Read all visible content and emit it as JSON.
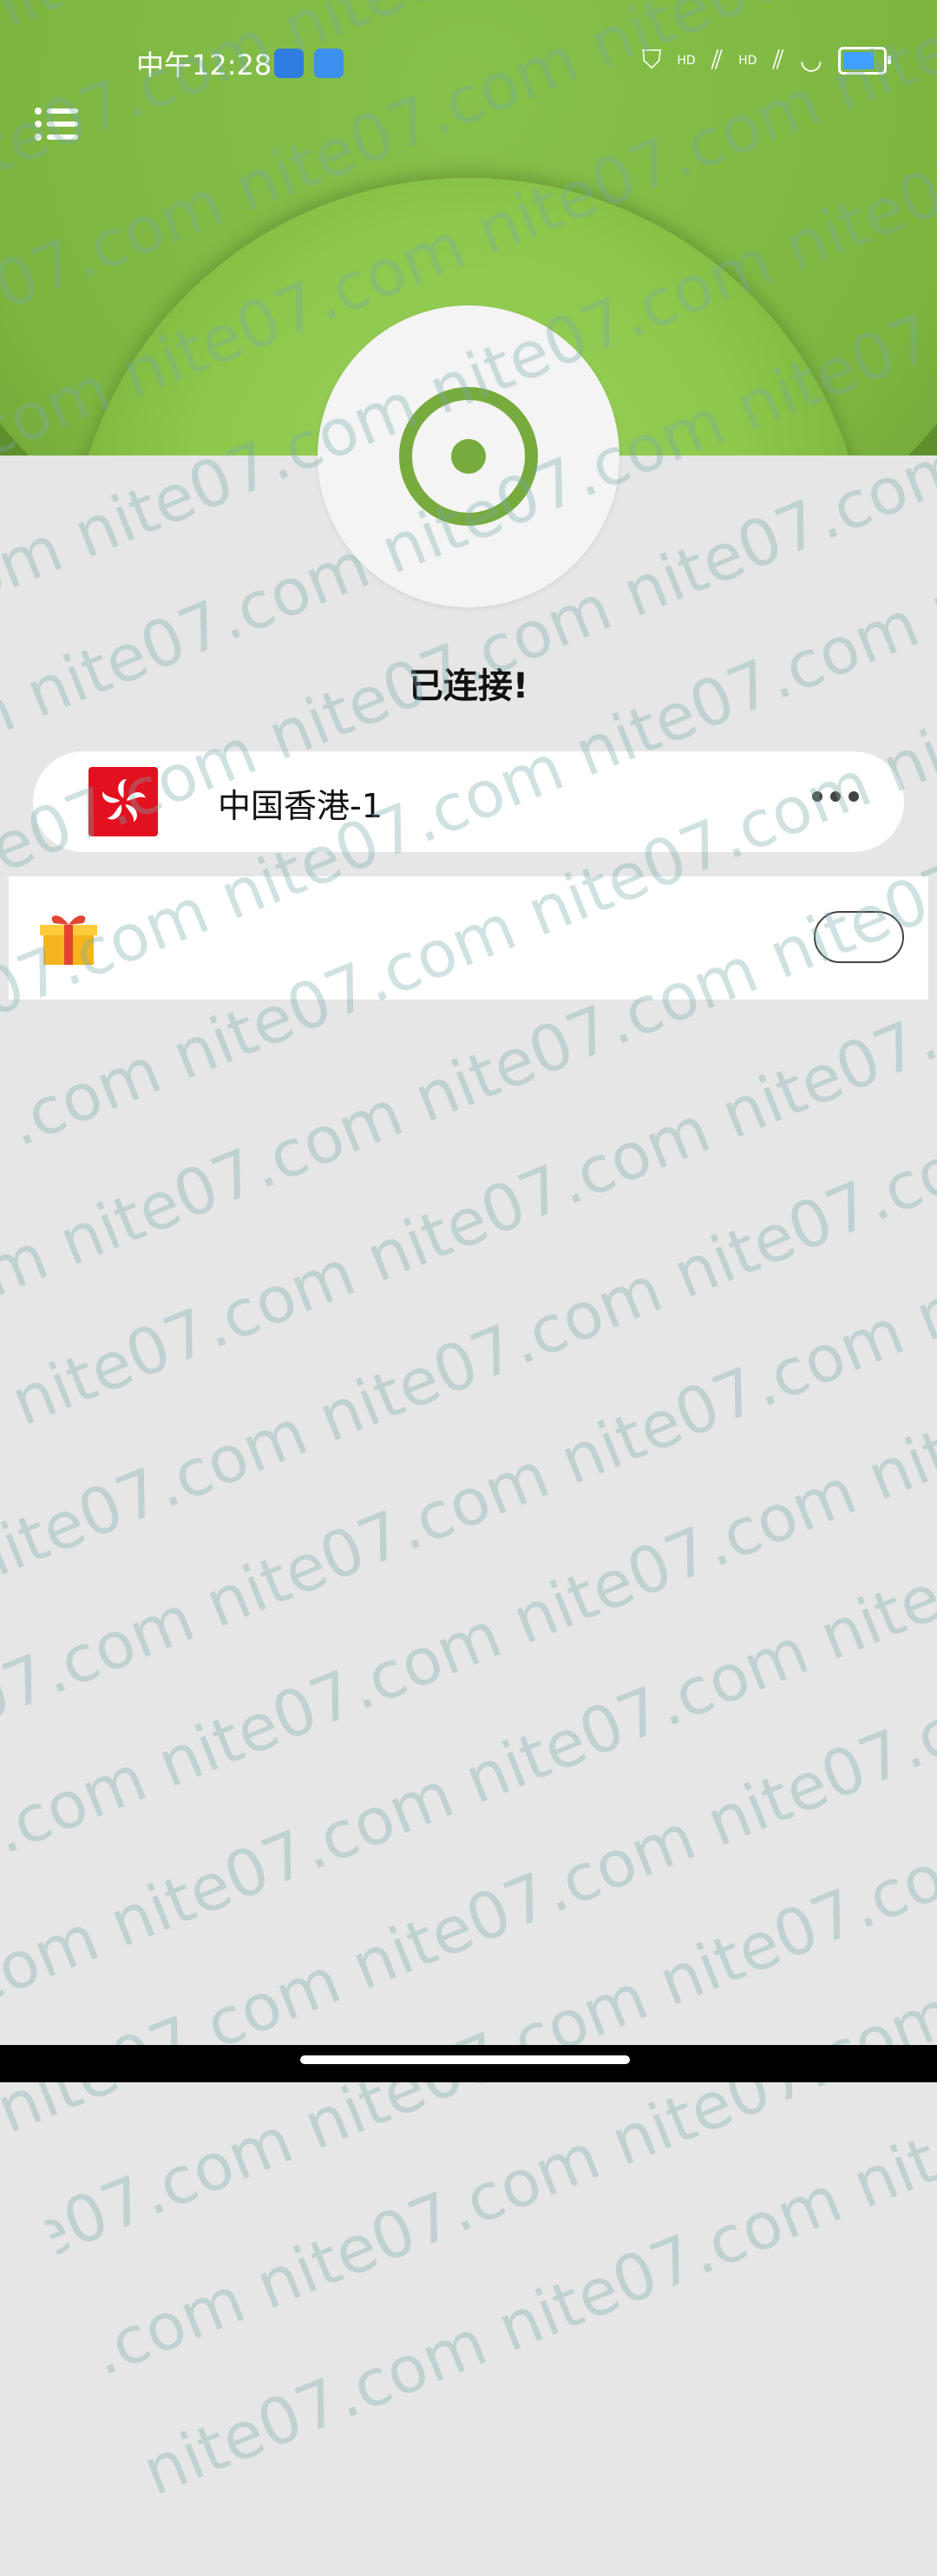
{
  "status_bar": {
    "time": "中午12:28",
    "hd_label_1": "HD",
    "hd_label_2": "HD"
  },
  "colors": {
    "accent_green": "#78ab3e",
    "flag_red": "#e3101f",
    "battery_blue": "#3fa0ff"
  },
  "main": {
    "connection_status": "已连接!",
    "server": {
      "name": "中国香港-1",
      "flag_icon": "hong-kong-flag-icon"
    },
    "promo": {
      "icon": "gift-icon",
      "toggle_state": "off"
    }
  },
  "watermark": {
    "text": "nite07.com nite07.com nite07.com nite07.com nite07.com nite07.com"
  }
}
